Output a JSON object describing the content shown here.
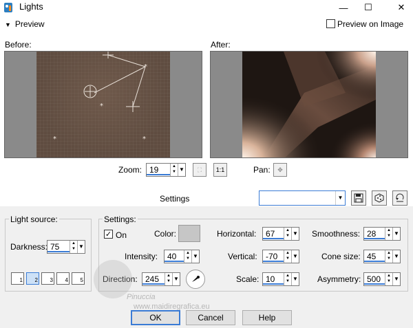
{
  "window": {
    "title": "Lights",
    "minimize_glyph": "—",
    "maximize_glyph": "☐",
    "close_glyph": "✕",
    "app_icon": "paintshop-icon"
  },
  "preview": {
    "toggle_label": "Preview",
    "preview_on_image_label": "Preview on Image",
    "preview_on_image_checked": false
  },
  "before": {
    "label": "Before:"
  },
  "after": {
    "label": "After:"
  },
  "zoom": {
    "label": "Zoom:",
    "value": "19",
    "fit_icon": "fit-window-icon",
    "actual_size_label": "1:1"
  },
  "pan": {
    "label": "Pan:",
    "icon": "pan-move-icon"
  },
  "settings_bar": {
    "label": "Settings",
    "preset_value": "",
    "save_icon": "save-icon",
    "random_icon": "randomize-icon",
    "reset_icon": "reset-icon"
  },
  "light_source": {
    "title": "Light source:",
    "darkness_label": "Darkness:",
    "darkness_value": "75",
    "presets": [
      "1",
      "2",
      "3",
      "4",
      "5"
    ],
    "selected_preset": "2"
  },
  "settings": {
    "title": "Settings:",
    "on_label": "On",
    "on_checked": true,
    "color_label": "Color:",
    "color_value": "#c6c6c6",
    "intensity_label": "Intensity:",
    "intensity_value": "40",
    "direction_label": "Direction:",
    "direction_value": "245",
    "horizontal_label": "Horizontal:",
    "horizontal_value": "67",
    "vertical_label": "Vertical:",
    "vertical_value": "-70",
    "scale_label": "Scale:",
    "scale_value": "10",
    "smoothness_label": "Smoothness:",
    "smoothness_value": "28",
    "cone_size_label": "Cone size:",
    "cone_size_value": "45",
    "asymmetry_label": "Asymmetry:",
    "asymmetry_value": "500"
  },
  "buttons": {
    "ok": "OK",
    "cancel": "Cancel",
    "help": "Help"
  },
  "watermark": {
    "line1": "Pinuccia",
    "line2": "www.maidiregrafica.eu"
  },
  "colors": {
    "accent": "#3a7bd5",
    "before_image": "#5f4c40",
    "after_dark": "#1e1612",
    "after_light": "#f7e8dd"
  }
}
